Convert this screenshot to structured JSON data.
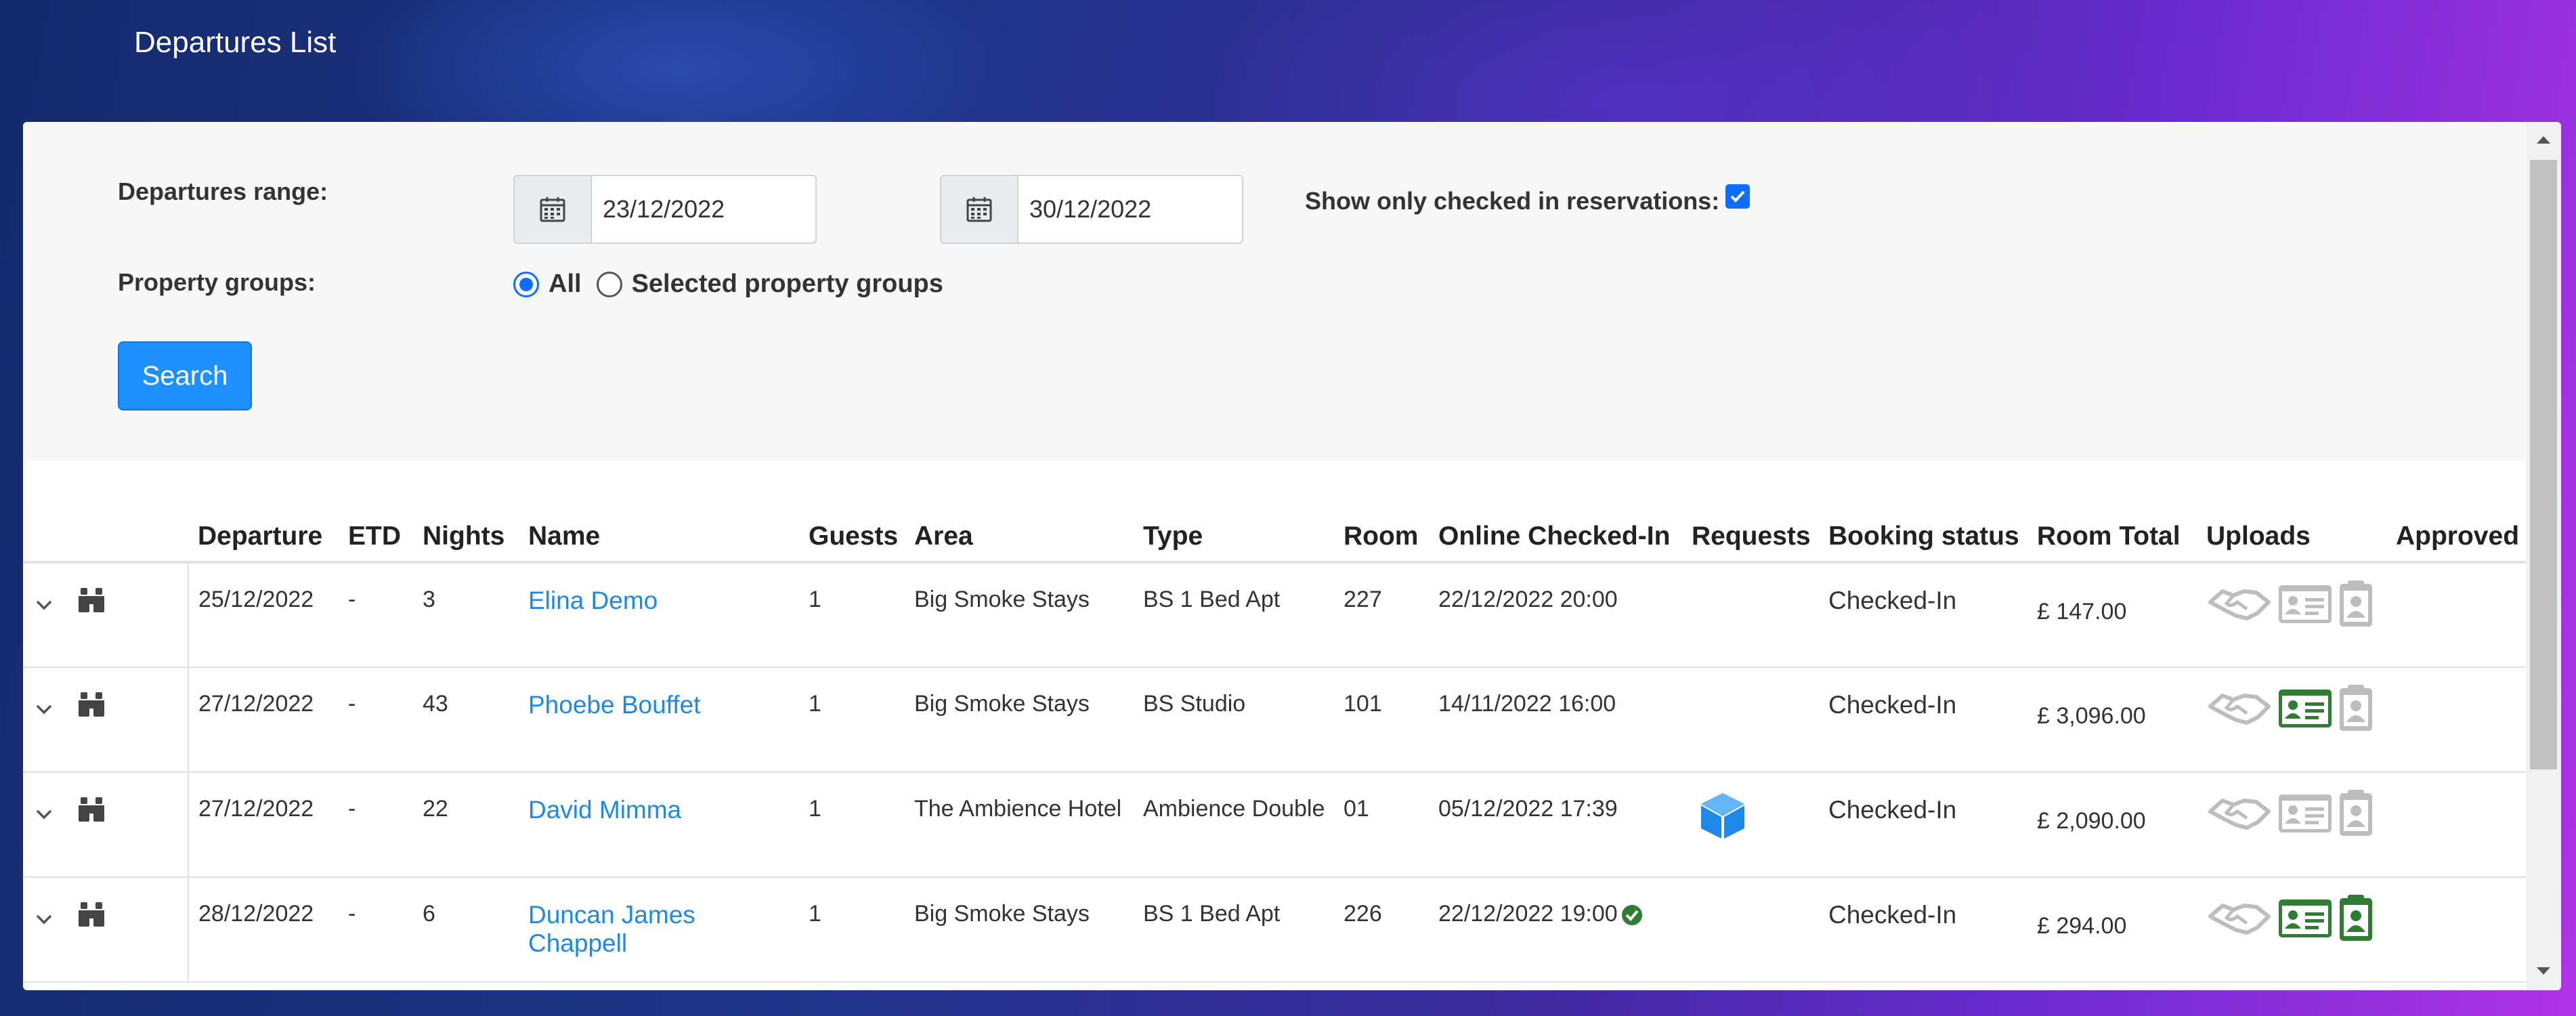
{
  "page": {
    "title": "Departures List"
  },
  "filters": {
    "range_label": "Departures range:",
    "date_from": "23/12/2022",
    "date_to": "30/12/2022",
    "checked_in_label": "Show only checked in reservations:",
    "checked_in_checked": true,
    "groups_label": "Property groups:",
    "groups_options": [
      "All",
      "Selected property groups"
    ],
    "groups_selected": "All",
    "search_label": "Search"
  },
  "table": {
    "headers": [
      "Departure",
      "ETD",
      "Nights",
      "Name",
      "Guests",
      "Area",
      "Type",
      "Room",
      "Online Checked-In",
      "Requests",
      "Booking status",
      "Room Total",
      "Uploads",
      "Approved"
    ],
    "rows": [
      {
        "departure": "25/12/2022",
        "etd": "-",
        "nights": "3",
        "name": "Elina Demo",
        "guests": "1",
        "area": "Big Smoke Stays",
        "type": "BS 1 Bed Apt",
        "room": "227",
        "online_checked_in": "22/12/2022 20:00",
        "verified": false,
        "has_request": false,
        "status": "Checked-In",
        "total": "£ 147.00",
        "uploads": {
          "agreement": false,
          "id_card": false,
          "photo": false
        }
      },
      {
        "departure": "27/12/2022",
        "etd": "-",
        "nights": "43",
        "name": "Phoebe Bouffet",
        "guests": "1",
        "area": "Big Smoke Stays",
        "type": "BS Studio",
        "room": "101",
        "online_checked_in": "14/11/2022 16:00",
        "verified": false,
        "has_request": false,
        "status": "Checked-In",
        "total": "£ 3,096.00",
        "uploads": {
          "agreement": false,
          "id_card": true,
          "photo": false
        }
      },
      {
        "departure": "27/12/2022",
        "etd": "-",
        "nights": "22",
        "name": "David Mimma",
        "guests": "1",
        "area": "The Ambience Hotel",
        "type": "Ambience Double",
        "room": "01",
        "online_checked_in": "05/12/2022 17:39",
        "verified": false,
        "has_request": true,
        "status": "Checked-In",
        "total": "£ 2,090.00",
        "uploads": {
          "agreement": false,
          "id_card": false,
          "photo": false
        }
      },
      {
        "departure": "28/12/2022",
        "etd": "-",
        "nights": "6",
        "name": "Duncan James Chappell",
        "guests": "1",
        "area": "Big Smoke Stays",
        "type": "BS 1 Bed Apt",
        "room": "226",
        "online_checked_in": "22/12/2022 19:00",
        "verified": true,
        "has_request": false,
        "status": "Checked-In",
        "total": "£ 294.00",
        "uploads": {
          "agreement": false,
          "id_card": true,
          "photo": true
        }
      }
    ]
  },
  "colors": {
    "link": "#1e88e5",
    "upload_on": "#2e7d32",
    "upload_off": "#bdbdbd",
    "primary": "#1e90ff",
    "request_icon": "#1e88e5"
  }
}
